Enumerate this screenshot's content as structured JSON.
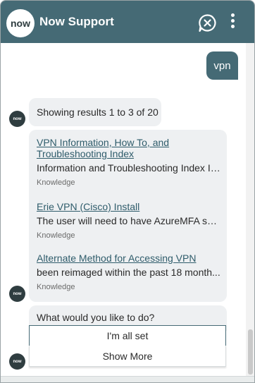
{
  "header": {
    "logo_text": "now",
    "title": "Now Support",
    "end_icon": "chat-close-icon",
    "menu_icon": "more-vertical-icon",
    "color": "#456a75"
  },
  "avatar_text": "now",
  "messages": {
    "user_text": "vpn",
    "summary": "Showing results 1 to 3 of 20",
    "results": [
      {
        "title": "VPN Information, How To, and Troubleshooting Index",
        "desc": "Information and Troubleshooting Index In...",
        "kind": "Knowledge"
      },
      {
        "title": "Erie VPN (Cisco) Install",
        "desc": "The user will need to have AzureMFA set...",
        "kind": "Knowledge"
      },
      {
        "title": "Alternate Method for Accessing VPN",
        "desc": "been reimaged within the past 18 month...",
        "kind": "Knowledge"
      }
    ],
    "prompt": "What would you like to do?",
    "options": [
      "I'm all set",
      "Show More"
    ]
  }
}
